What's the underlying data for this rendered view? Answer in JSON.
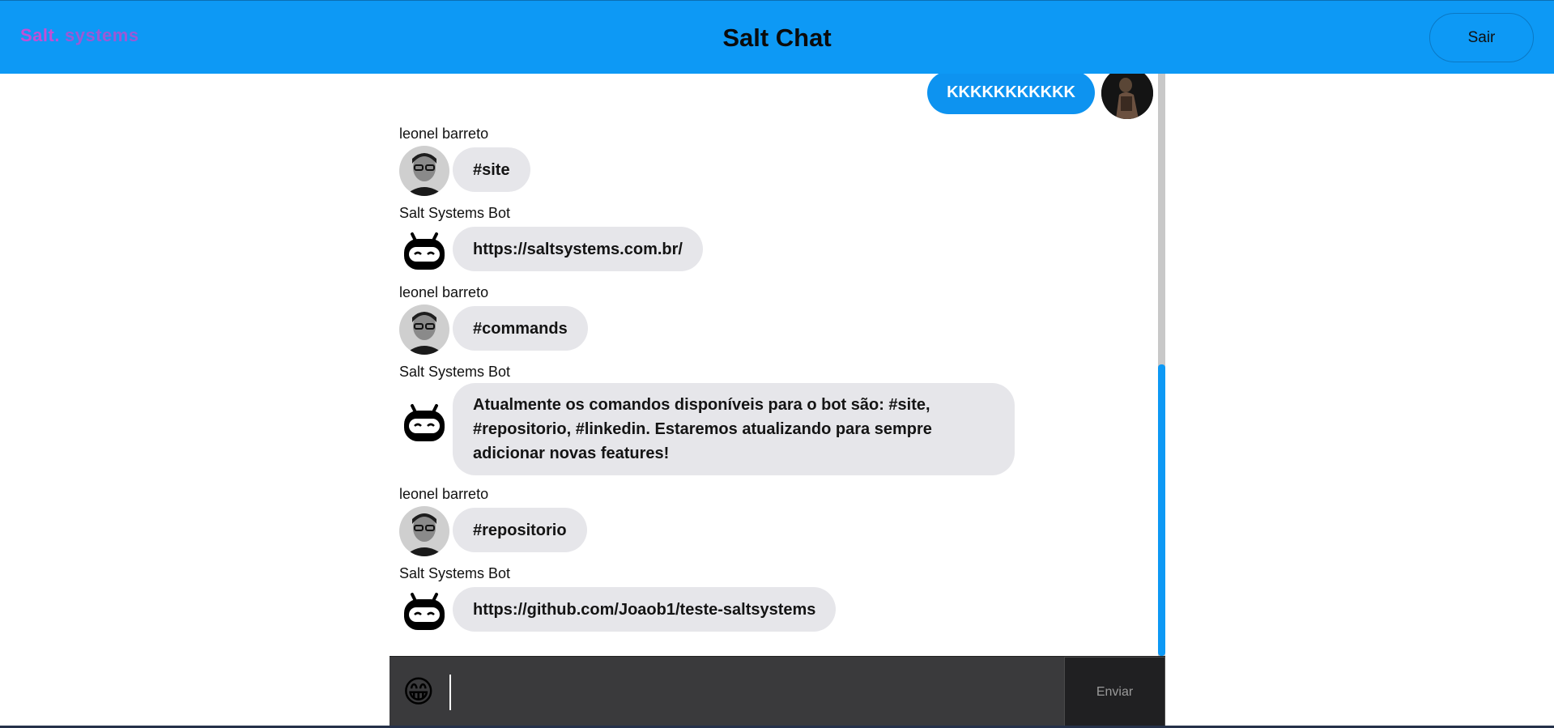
{
  "header": {
    "logo_salt": "Salt",
    "logo_dot": ".",
    "logo_systems": "systems",
    "title": "Salt Chat",
    "logout_label": "Sair"
  },
  "messages": {
    "own": {
      "text": "KKKKKKKKKKK"
    },
    "items": [
      {
        "sender": "leonel barreto",
        "text": "#site",
        "avatar": "user-photo"
      },
      {
        "sender": "Salt Systems Bot",
        "text": "https://saltsystems.com.br/",
        "avatar": "bot-icon"
      },
      {
        "sender": "leonel barreto",
        "text": "#commands",
        "avatar": "user-photo"
      },
      {
        "sender": "Salt Systems Bot",
        "text": "Atualmente os comandos disponíveis para o bot são: #site, #repositorio, #linkedin. Estaremos atualizando para sempre adicionar novas features!",
        "avatar": "bot-icon"
      },
      {
        "sender": "leonel barreto",
        "text": "#repositorio",
        "avatar": "user-photo"
      },
      {
        "sender": "Salt Systems Bot",
        "text": "https://github.com/Joaob1/teste-saltsystems",
        "avatar": "bot-icon"
      }
    ]
  },
  "composer": {
    "emoji": "😁",
    "input_value": "",
    "send_label": "Enviar"
  },
  "colors": {
    "primary": "#0d99f5",
    "bubble": "#e6e6ea",
    "composer": "#3a3a3c"
  }
}
